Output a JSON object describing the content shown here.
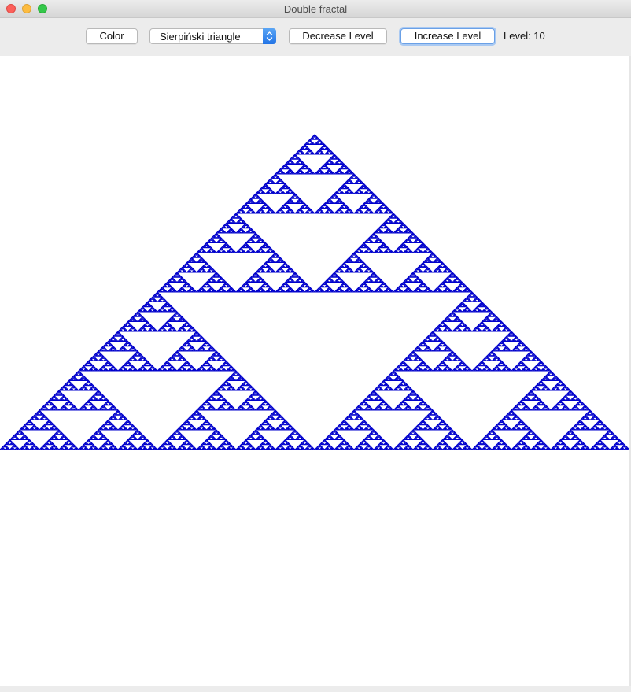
{
  "window": {
    "title": "Double fractal"
  },
  "toolbar": {
    "color_label": "Color",
    "fractal_select_value": "Sierpiński triangle",
    "decrease_label": "Decrease Level",
    "increase_label": "Increase Level",
    "level_text": "Level: 10"
  },
  "fractal": {
    "type": "Sierpiński triangle",
    "level": 10,
    "color": "#0000cc"
  },
  "colors": {
    "canvas_background": "#ffffff",
    "focus_ring": "#6aa0e6",
    "select_arrow": "#2274e6"
  }
}
